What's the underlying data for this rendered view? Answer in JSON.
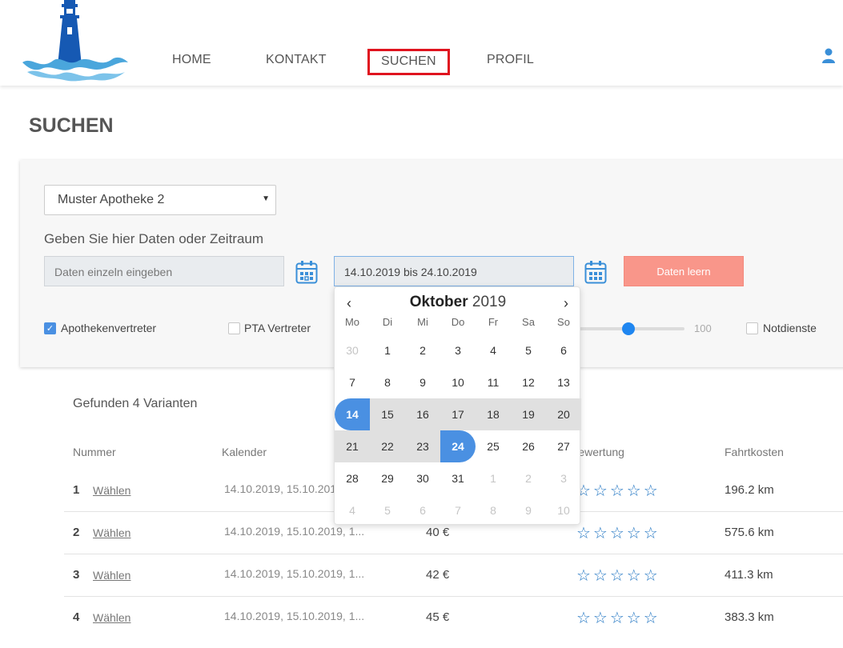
{
  "nav": {
    "items": [
      {
        "label": "HOME"
      },
      {
        "label": "KONTAKT"
      },
      {
        "label": "SUCHEN"
      },
      {
        "label": "PROFIL"
      }
    ]
  },
  "page": {
    "title": "SUCHEN"
  },
  "filters": {
    "pharmacy_select": "Muster Apotheke 2",
    "hint": "Geben Sie hier Daten oder Zeitraum",
    "single_dates_placeholder": "Daten einzeln eingeben",
    "range_value": "14.10.2019 bis 24.10.2019",
    "clear_button": "Daten leern",
    "checkbox_apothekenvertreter": "Apothekenvertreter",
    "checkbox_apothekenvertreter_checked": true,
    "checkbox_pta": "PTA Vertreter",
    "checkbox_pta_checked": false,
    "slider_max": "100",
    "slider_value_fraction": 0.45,
    "checkbox_notdienste": "Notdienste",
    "checkbox_notdienste_checked": false
  },
  "datepicker": {
    "month": "Oktober",
    "year": "2019",
    "weekdays": [
      "Mo",
      "Di",
      "Mi",
      "Do",
      "Fr",
      "Sa",
      "So"
    ],
    "weeks": [
      [
        {
          "d": "30",
          "s": "muted"
        },
        {
          "d": "1"
        },
        {
          "d": "2"
        },
        {
          "d": "3"
        },
        {
          "d": "4"
        },
        {
          "d": "5"
        },
        {
          "d": "6"
        }
      ],
      [
        {
          "d": "7"
        },
        {
          "d": "8"
        },
        {
          "d": "9"
        },
        {
          "d": "10"
        },
        {
          "d": "11"
        },
        {
          "d": "12"
        },
        {
          "d": "13"
        }
      ],
      [
        {
          "d": "14",
          "s": "start"
        },
        {
          "d": "15",
          "s": "inrange"
        },
        {
          "d": "16",
          "s": "inrange"
        },
        {
          "d": "17",
          "s": "inrange"
        },
        {
          "d": "18",
          "s": "inrange"
        },
        {
          "d": "19",
          "s": "inrange"
        },
        {
          "d": "20",
          "s": "inrange"
        }
      ],
      [
        {
          "d": "21",
          "s": "inrange"
        },
        {
          "d": "22",
          "s": "inrange"
        },
        {
          "d": "23",
          "s": "inrange"
        },
        {
          "d": "24",
          "s": "end"
        },
        {
          "d": "25"
        },
        {
          "d": "26"
        },
        {
          "d": "27"
        }
      ],
      [
        {
          "d": "28"
        },
        {
          "d": "29"
        },
        {
          "d": "30"
        },
        {
          "d": "31"
        },
        {
          "d": "1",
          "s": "muted"
        },
        {
          "d": "2",
          "s": "muted"
        },
        {
          "d": "3",
          "s": "muted"
        }
      ],
      [
        {
          "d": "4",
          "s": "muted"
        },
        {
          "d": "5",
          "s": "muted"
        },
        {
          "d": "6",
          "s": "muted"
        },
        {
          "d": "7",
          "s": "muted"
        },
        {
          "d": "8",
          "s": "muted"
        },
        {
          "d": "9",
          "s": "muted"
        },
        {
          "d": "10",
          "s": "muted"
        }
      ]
    ]
  },
  "results": {
    "found_text": "Gefunden 4 Varianten",
    "headers": {
      "nummer": "Nummer",
      "kalender": "Kalender",
      "bewertung": "Bewertung",
      "fahrtkosten": "Fahrtkosten"
    },
    "select_label": "Wählen",
    "rows": [
      {
        "nummer": "1",
        "kalender": "14.10.2019, 15.10.2019, 1...",
        "preis": "",
        "stars": "☆☆☆☆☆",
        "fahrtkosten": "196.2 km"
      },
      {
        "nummer": "2",
        "kalender": "14.10.2019, 15.10.2019, 1...",
        "preis": "40 €",
        "stars": "☆☆☆☆☆",
        "fahrtkosten": "575.6 km"
      },
      {
        "nummer": "3",
        "kalender": "14.10.2019, 15.10.2019, 1...",
        "preis": "42 €",
        "stars": "☆☆☆☆☆",
        "fahrtkosten": "411.3 km"
      },
      {
        "nummer": "4",
        "kalender": "14.10.2019, 15.10.2019, 1...",
        "preis": "45 €",
        "stars": "☆☆☆☆☆",
        "fahrtkosten": "383.3 km"
      }
    ]
  },
  "colors": {
    "accent": "#4a90e2",
    "clear_button": "#f9968a",
    "nav_highlight": "#e0131f",
    "star": "#2779c4"
  }
}
